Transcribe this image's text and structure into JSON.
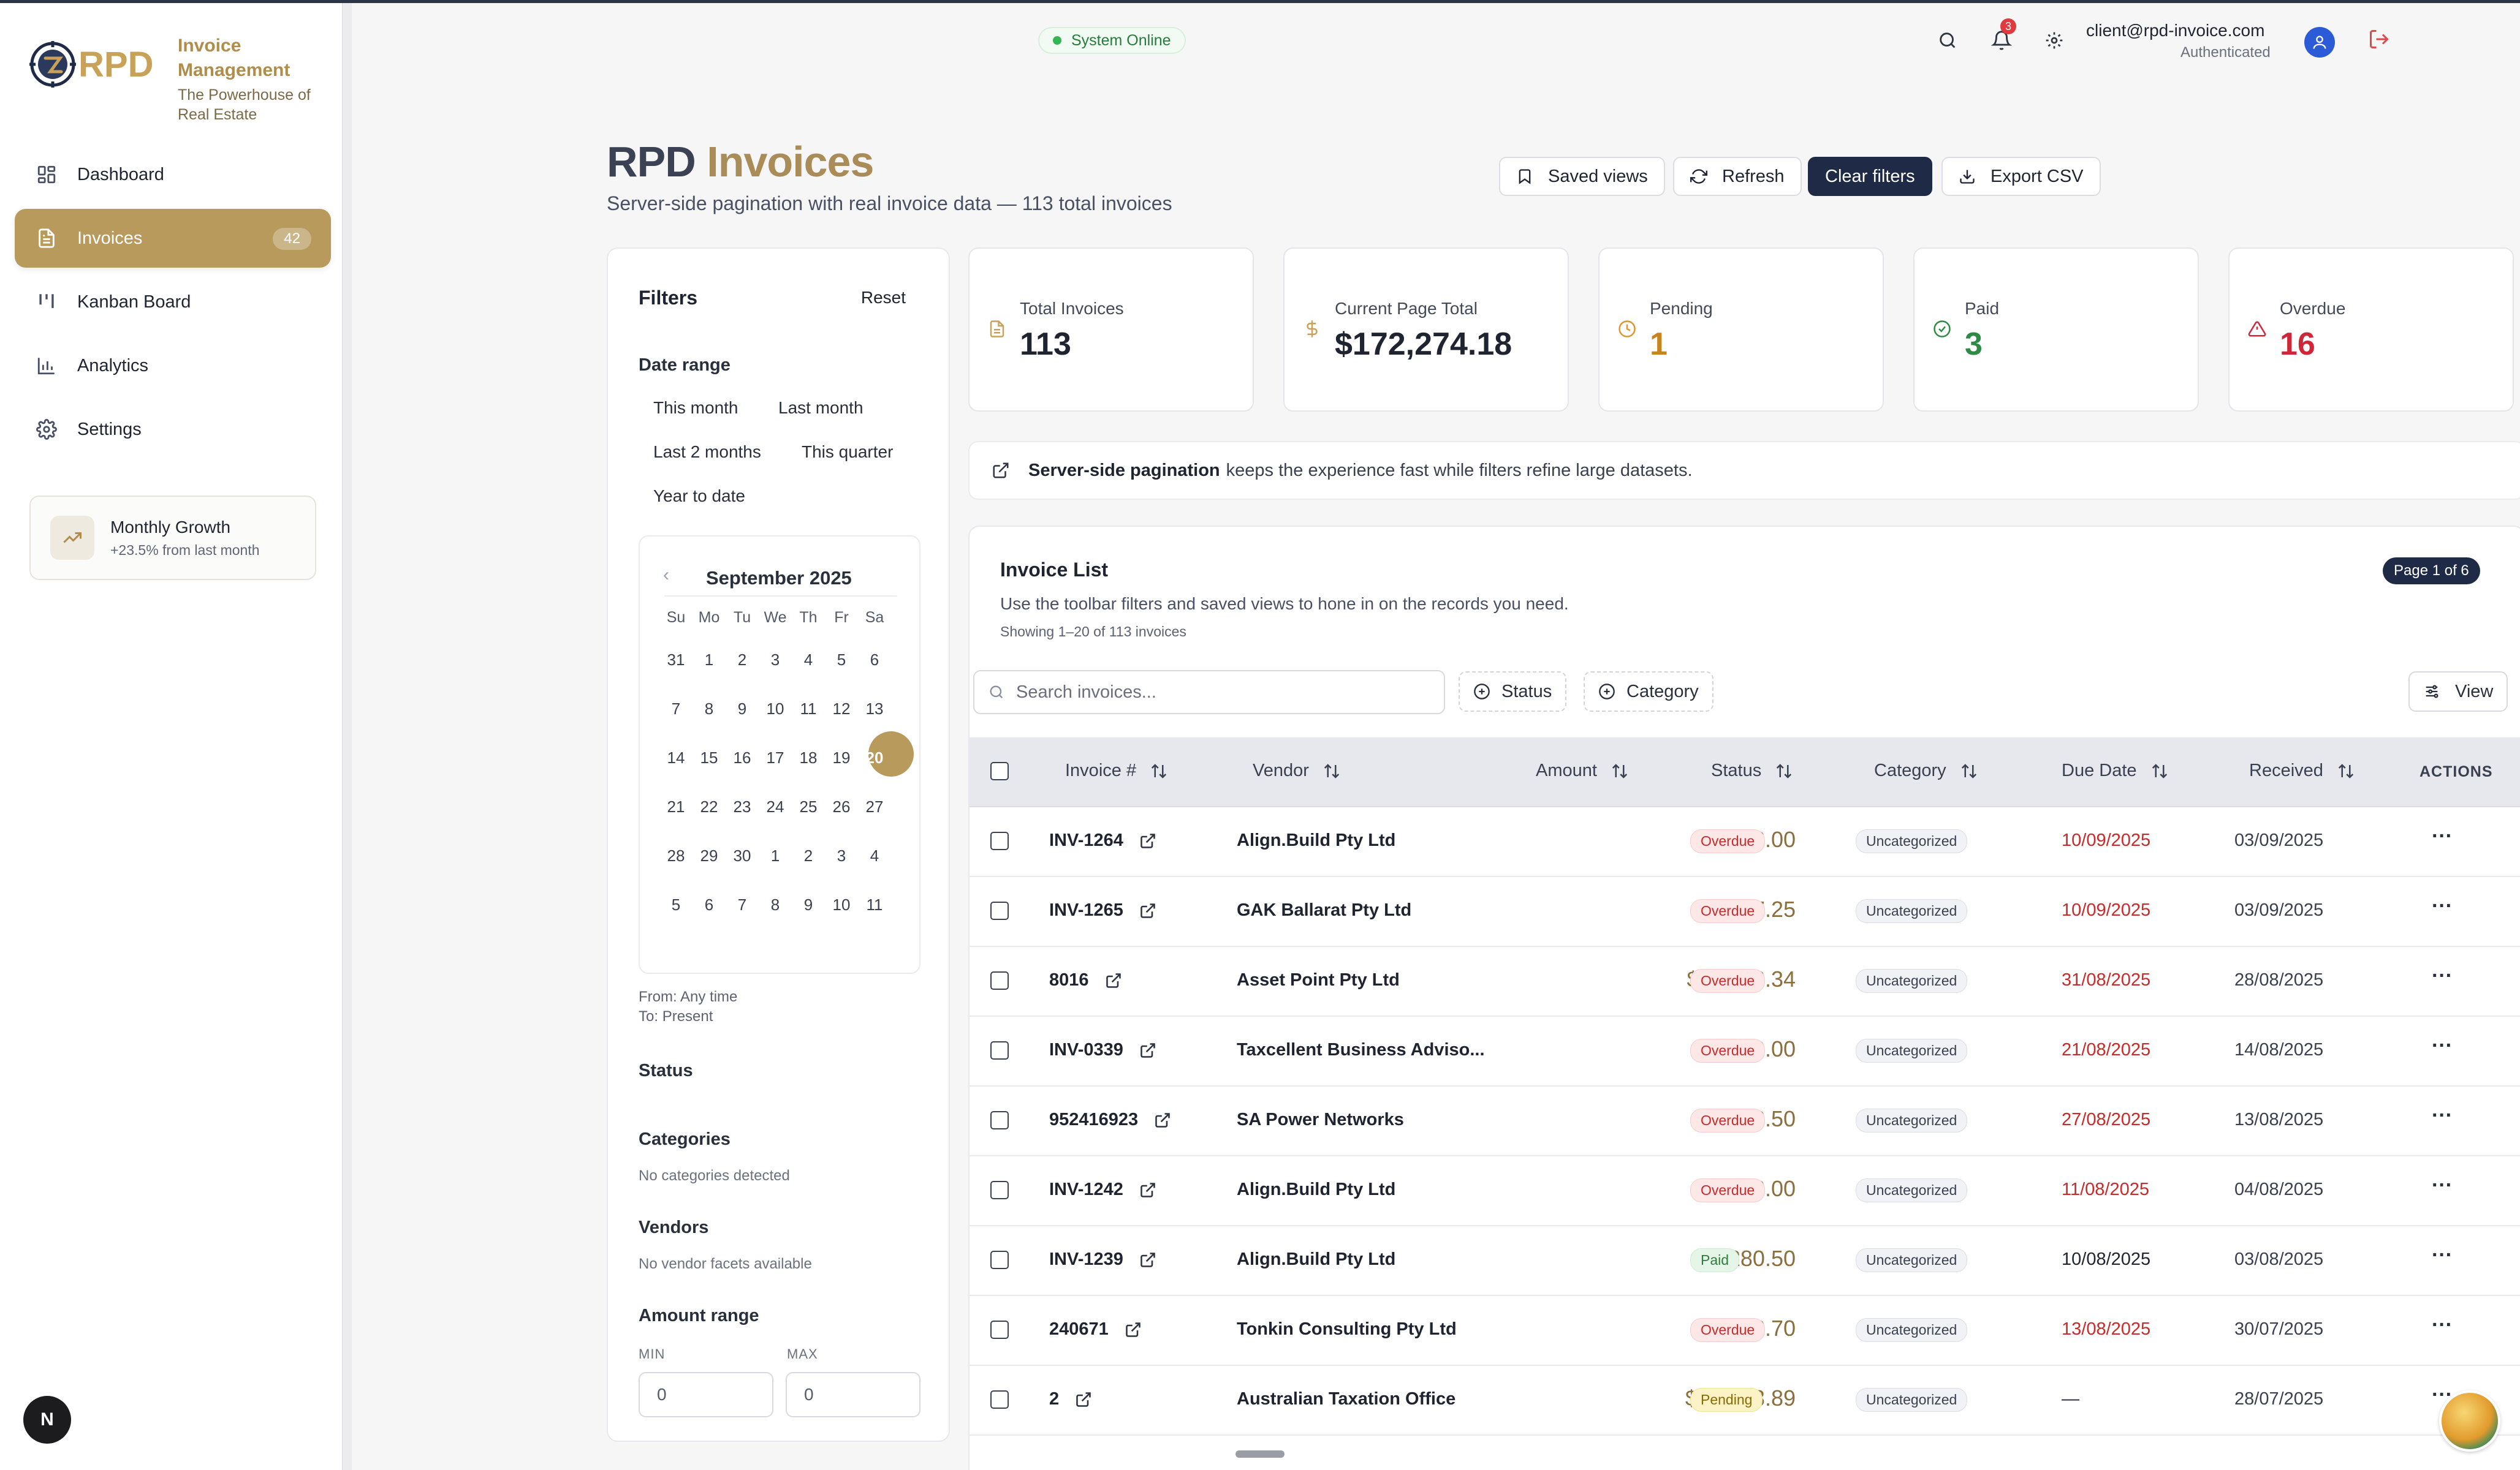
{
  "app": {
    "brand_title": "Invoice Management",
    "brand_sub": "The Powerhouse of Real Estate",
    "logo_text": "RPD"
  },
  "sidebar": {
    "items": [
      {
        "label": "Dashboard",
        "icon": "dashboard-grid-icon"
      },
      {
        "label": "Invoices",
        "icon": "document-icon",
        "badge": "42",
        "active": true
      },
      {
        "label": "Kanban Board",
        "icon": "kanban-icon"
      },
      {
        "label": "Analytics",
        "icon": "bar-chart-icon"
      },
      {
        "label": "Settings",
        "icon": "gear-icon"
      }
    ],
    "growth": {
      "title": "Monthly Growth",
      "sub": "+23.5% from last month"
    },
    "n_button": "N"
  },
  "topbar": {
    "status": "System Online",
    "notifications": "3",
    "email": "client@rpd-invoice.com",
    "auth": "Authenticated"
  },
  "header": {
    "title_1": "RPD",
    "title_2": "Invoices",
    "subtitle": "Server-side pagination with real invoice data — 113 total invoices",
    "buttons": {
      "saved_views": "Saved views",
      "refresh": "Refresh",
      "clear_filters": "Clear filters",
      "export_csv": "Export CSV"
    }
  },
  "filters": {
    "title": "Filters",
    "reset": "Reset",
    "date_range_label": "Date range",
    "presets": [
      "This month",
      "Last month",
      "Last 2 months",
      "This quarter",
      "Year to date"
    ],
    "calendar": {
      "month": "September 2025",
      "weekdays": [
        "Su",
        "Mo",
        "Tu",
        "We",
        "Th",
        "Fr",
        "Sa"
      ],
      "weeks": [
        [
          "31",
          "1",
          "2",
          "3",
          "4",
          "5",
          "6"
        ],
        [
          "7",
          "8",
          "9",
          "10",
          "11",
          "12",
          "13"
        ],
        [
          "14",
          "15",
          "16",
          "17",
          "18",
          "19",
          "20"
        ],
        [
          "21",
          "22",
          "23",
          "24",
          "25",
          "26",
          "27"
        ],
        [
          "28",
          "29",
          "30",
          "1",
          "2",
          "3",
          "4"
        ],
        [
          "5",
          "6",
          "7",
          "8",
          "9",
          "10",
          "11"
        ]
      ],
      "selected": "20"
    },
    "from_label": "From:",
    "from_value": "Any time",
    "to_label": "To:",
    "to_value": "Present",
    "status_label": "Status",
    "categories_label": "Categories",
    "categories_empty": "No categories detected",
    "vendors_label": "Vendors",
    "vendors_empty": "No vendor facets available",
    "amount_label": "Amount range",
    "min_label": "MIN",
    "max_label": "MAX",
    "min_value": "0",
    "max_value": "0"
  },
  "stats": [
    {
      "label": "Total Invoices",
      "value": "113",
      "icon": "document-icon",
      "color": "#1f2430",
      "icon_color": "#c9a25a"
    },
    {
      "label": "Current Page Total",
      "value": "$172,274.18",
      "icon": "dollar-icon",
      "color": "#1f2430",
      "icon_color": "#c9a25a"
    },
    {
      "label": "Pending",
      "value": "1",
      "icon": "clock-icon",
      "color": "#c98420",
      "icon_color": "#e0962c"
    },
    {
      "label": "Paid",
      "value": "3",
      "icon": "check-circle-icon",
      "color": "#2e8b45",
      "icon_color": "#2e8b45"
    },
    {
      "label": "Overdue",
      "value": "16",
      "icon": "alert-triangle-icon",
      "color": "#d0263a",
      "icon_color": "#d0263a"
    }
  ],
  "banner": {
    "bold": "Server-side pagination",
    "text": "keeps the experience fast while filters refine large datasets."
  },
  "list": {
    "title": "Invoice List",
    "sub": "Use the toolbar filters and saved views to hone in on the records you need.",
    "showing": "Showing 1–20 of 113 invoices",
    "page_badge": "Page 1 of 6",
    "search_placeholder": "Search invoices...",
    "status_btn": "Status",
    "category_btn": "Category",
    "view_btn": "View",
    "columns": {
      "invoice": "Invoice #",
      "vendor": "Vendor",
      "amount": "Amount",
      "status": "Status",
      "category": "Category",
      "due": "Due Date",
      "received": "Received",
      "actions": "ACTIONS"
    },
    "rows": [
      {
        "invoice": "INV-1264",
        "vendor": "Align.Build Pty Ltd",
        "amount": "$1,012.00",
        "status": "Overdue",
        "category": "Uncategorized",
        "due": "10/09/2025",
        "due_red": true,
        "received": "03/09/2025"
      },
      {
        "invoice": "INV-1265",
        "vendor": "GAK Ballarat Pty Ltd",
        "amount": "$327.25",
        "status": "Overdue",
        "category": "Uncategorized",
        "due": "10/09/2025",
        "due_red": true,
        "received": "03/09/2025"
      },
      {
        "invoice": "8016",
        "vendor": "Asset Point Pty Ltd",
        "amount": "$11,142.34",
        "status": "Overdue",
        "category": "Uncategorized",
        "due": "31/08/2025",
        "due_red": true,
        "received": "28/08/2025"
      },
      {
        "invoice": "INV-0339",
        "vendor": "Taxcellent Business Adviso...",
        "amount": "$2,200.00",
        "status": "Overdue",
        "category": "Uncategorized",
        "due": "21/08/2025",
        "due_red": true,
        "received": "14/08/2025"
      },
      {
        "invoice": "952416923",
        "vendor": "SA Power Networks",
        "amount": "$5,912.50",
        "status": "Overdue",
        "category": "Uncategorized",
        "due": "27/08/2025",
        "due_red": true,
        "received": "13/08/2025"
      },
      {
        "invoice": "INV-1242",
        "vendor": "Align.Build Pty Ltd",
        "amount": "$6,248.00",
        "status": "Overdue",
        "category": "Uncategorized",
        "due": "11/08/2025",
        "due_red": true,
        "received": "04/08/2025"
      },
      {
        "invoice": "INV-1239",
        "vendor": "Align.Build Pty Ltd",
        "amount": "$280.50",
        "status": "Paid",
        "category": "Uncategorized",
        "due": "10/08/2025",
        "due_red": false,
        "received": "03/08/2025"
      },
      {
        "invoice": "240671",
        "vendor": "Tonkin Consulting Pty Ltd",
        "amount": "$5,298.70",
        "status": "Overdue",
        "category": "Uncategorized",
        "due": "13/08/2025",
        "due_red": true,
        "received": "30/07/2025"
      },
      {
        "invoice": "2",
        "vendor": "Australian Taxation Office",
        "amount": "$20,193.89",
        "status": "Pending",
        "category": "Uncategorized",
        "due": "—",
        "due_red": false,
        "received": "28/07/2025"
      }
    ],
    "actions_glyph": "···"
  }
}
